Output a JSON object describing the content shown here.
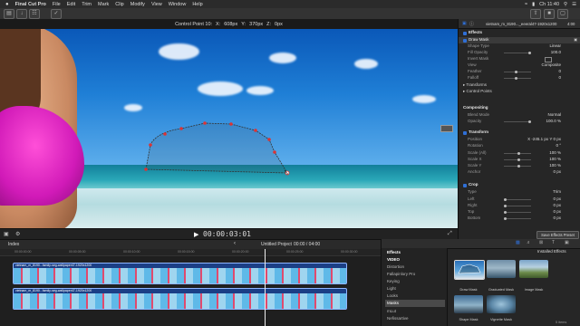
{
  "menubar": {
    "apple": "",
    "app": "Final Cut Pro",
    "items": [
      "File",
      "Edit",
      "Trim",
      "Mark",
      "Clip",
      "Modify",
      "View",
      "Window",
      "Help"
    ],
    "clock": "Ch 11:40"
  },
  "viewer": {
    "title": "Control Point 10:",
    "x_label": "X:",
    "x_value": "608px",
    "y_label": "Y:",
    "y_value": "370px",
    "z_label": "Z:",
    "z_value": "0px",
    "timecode": "00:00:03:01"
  },
  "inspector": {
    "clip_name": "vietnam_m_8190..._eeeral47-1920x1200",
    "duration": "4:00",
    "effects_header": "Effects",
    "rows": [
      {
        "type": "check",
        "label": "Draw Mask",
        "val": ""
      },
      {
        "type": "param",
        "label": "Shape Type",
        "val": "Linear"
      },
      {
        "type": "param",
        "label": "Fill Opacity",
        "val": "100.0"
      },
      {
        "type": "param",
        "label": "Invert Mask",
        "val": ""
      },
      {
        "type": "param",
        "label": "View",
        "val": "Composite"
      },
      {
        "type": "param",
        "label": "Feather",
        "val": "0"
      },
      {
        "type": "param",
        "label": "Falloff",
        "val": "0"
      },
      {
        "type": "sub",
        "label": "▸ Transforms",
        "val": ""
      },
      {
        "type": "sub",
        "label": "▸ Control Points",
        "val": ""
      }
    ],
    "compositing_header": "Compositing",
    "compositing_rows": [
      {
        "label": "Blend Mode",
        "val": "Normal"
      },
      {
        "label": "Opacity",
        "val": "100.0 %"
      }
    ],
    "transform_header": "Transform",
    "transform_rows": [
      {
        "label": "Position",
        "val": "X  -245.1 px   Y  0 px"
      },
      {
        "label": "Rotation",
        "val": "0 °"
      },
      {
        "label": "Scale (All)",
        "val": "100 %"
      },
      {
        "label": "Scale X",
        "val": "100 %"
      },
      {
        "label": "Scale Y",
        "val": "100 %"
      },
      {
        "label": "Anchor",
        "val": "0 px"
      }
    ],
    "crop_header": "Crop",
    "crop_rows": [
      {
        "label": "Type",
        "val": "Trim"
      },
      {
        "label": "Left",
        "val": "0 px"
      },
      {
        "label": "Right",
        "val": "0 px"
      },
      {
        "label": "Top",
        "val": "0 px"
      },
      {
        "label": "Bottom",
        "val": "0 px"
      }
    ],
    "save_preset": "Save Effects Preset"
  },
  "timeline": {
    "index_label": "Index",
    "project": "Untitled Project",
    "duration": "00:00 / 04:00",
    "clip1_name": "vietnam_m_8190...family-seg-wallpaper47-1920x1200",
    "clip2_name": "vietnam_m_8190...family-seg-wallpaper47-1920x1200",
    "ruler_marks": [
      "00:00:00:00",
      "00:00:05:00",
      "00:00:10:00",
      "00:00:15:00",
      "00:00:20:00",
      "00:00:25:00",
      "00:00:30:00"
    ]
  },
  "effects_browser": {
    "title": "Installed Effects",
    "categories": [
      {
        "label": "Effects",
        "kind": "hdr"
      },
      {
        "label": "VIDEO",
        "kind": "hdr"
      },
      {
        "label": "Distortion",
        "kind": "item"
      },
      {
        "label": "Fallapinlory Pro",
        "kind": "item"
      },
      {
        "label": "Keying",
        "kind": "item"
      },
      {
        "label": "Light",
        "kind": "item"
      },
      {
        "label": "Looks",
        "kind": "item"
      },
      {
        "label": "Masks",
        "kind": "sel"
      },
      {
        "label": "mLut",
        "kind": "item"
      },
      {
        "label": "Nefissartive",
        "kind": "item"
      }
    ],
    "items": [
      {
        "label": "Draw Mask",
        "icon": "draw-mask-thumbnail"
      },
      {
        "label": "Graduated Mask",
        "icon": "graduated-mask-thumbnail"
      },
      {
        "label": "Image Mask",
        "icon": "image-mask-thumbnail"
      },
      {
        "label": "Shape Mask",
        "icon": "shape-mask-thumbnail"
      },
      {
        "label": "Vignette Mask",
        "icon": "vignette-mask-thumbnail"
      }
    ],
    "count": "5 items"
  },
  "colors": {
    "accent": "#2f6fd6",
    "clip_border": "#8fb6ff",
    "clip_fill": "#1b3f86",
    "bikini": "#d11ab8"
  }
}
